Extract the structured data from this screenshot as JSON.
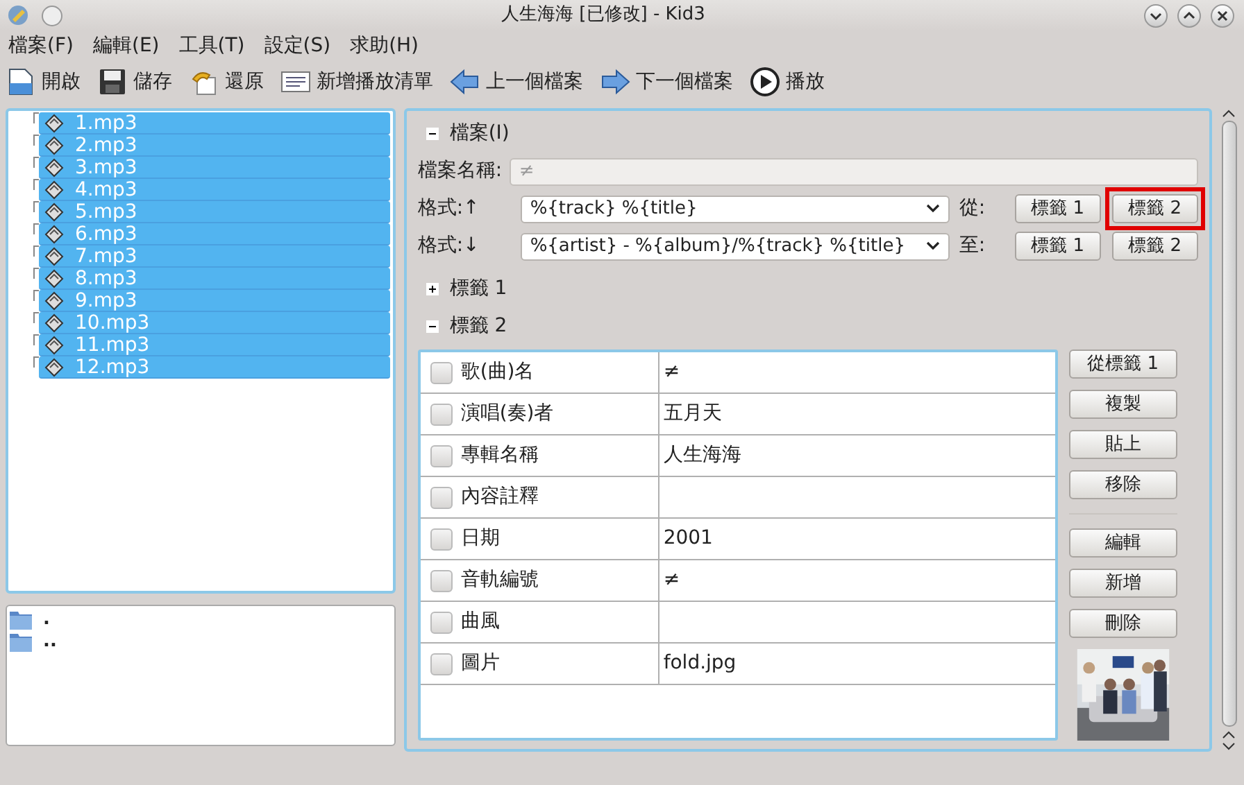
{
  "window": {
    "title": "人生海海  [已修改] - Kid3"
  },
  "menu": [
    "檔案(F)",
    "編輯(E)",
    "工具(T)",
    "設定(S)",
    "求助(H)"
  ],
  "toolbar": [
    {
      "kind": "open",
      "label": "開啟"
    },
    {
      "kind": "save",
      "label": "儲存"
    },
    {
      "kind": "revert",
      "label": "還原"
    },
    {
      "kind": "playlist",
      "label": "新增播放清單"
    },
    {
      "kind": "previous",
      "label": "上一個檔案"
    },
    {
      "kind": "next",
      "label": "下一個檔案"
    },
    {
      "kind": "play",
      "label": "播放"
    }
  ],
  "files": [
    {
      "name": "1.mp3",
      "selected": true
    },
    {
      "name": "2.mp3",
      "selected": true
    },
    {
      "name": "3.mp3",
      "selected": true
    },
    {
      "name": "4.mp3",
      "selected": true
    },
    {
      "name": "5.mp3",
      "selected": true
    },
    {
      "name": "6.mp3",
      "selected": true
    },
    {
      "name": "7.mp3",
      "selected": true
    },
    {
      "name": "8.mp3",
      "selected": true
    },
    {
      "name": "9.mp3",
      "selected": true
    },
    {
      "name": "10.mp3",
      "selected": true
    },
    {
      "name": "11.mp3",
      "selected": true
    },
    {
      "name": "12.mp3",
      "selected": true
    }
  ],
  "directories": [
    ".",
    ".."
  ],
  "file_section": {
    "header": "檔案(I)",
    "expanded": true,
    "filename_label": "檔案名稱:",
    "filename_value": "≠",
    "formats": [
      {
        "label": "格式:↑",
        "value": "%{track} %{title}",
        "direction_label": "從:",
        "buttons": [
          {
            "label": "標籤 1",
            "highlighted": false
          },
          {
            "label": "標籤 2",
            "highlighted": true
          }
        ]
      },
      {
        "label": "格式:↓",
        "value": "%{artist} - %{album}/%{track} %{title}",
        "direction_label": "至:",
        "buttons": [
          {
            "label": "標籤 1",
            "highlighted": false
          },
          {
            "label": "標籤 2",
            "highlighted": false
          }
        ]
      }
    ]
  },
  "tag1_section": {
    "header": "標籤 1",
    "expanded": false
  },
  "tag2_section": {
    "header": "標籤 2",
    "expanded": true,
    "fields": [
      {
        "name": "歌(曲)名",
        "value": "≠",
        "checked": false
      },
      {
        "name": "演唱(奏)者",
        "value": "五月天",
        "checked": false
      },
      {
        "name": "專輯名稱",
        "value": "人生海海",
        "checked": false
      },
      {
        "name": "內容註釋",
        "checked": false
      },
      {
        "name": "日期",
        "value": "2001",
        "checked": false
      },
      {
        "name": "音軌編號",
        "value": "≠",
        "checked": false
      },
      {
        "name": "曲風",
        "checked": false
      },
      {
        "name": "圖片",
        "value": "fold.jpg",
        "checked": false
      }
    ],
    "buttons": [
      "從標籤 1",
      "複製",
      "貼上",
      "移除"
    ],
    "buttons_2": [
      "編輯",
      "新增",
      "刪除"
    ],
    "cover": {
      "kind": "picture"
    }
  }
}
